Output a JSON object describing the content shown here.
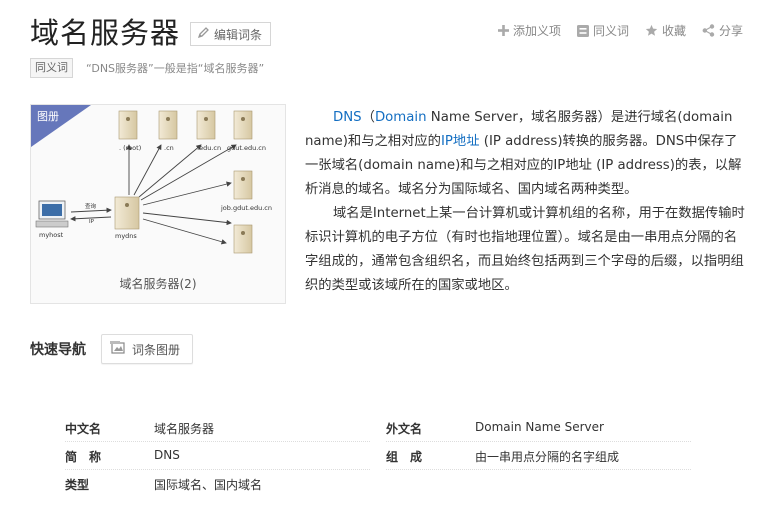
{
  "header": {
    "title": "域名服务器",
    "edit_label": "编辑词条",
    "actions": {
      "add_item": "添加义项",
      "synonym": "同义词",
      "favorite": "收藏",
      "share": "分享"
    }
  },
  "synonym": {
    "tag": "同义词",
    "text": "“DNS服务器”一般是指“域名服务器”"
  },
  "album": {
    "tag": "图册",
    "caption": "域名服务器(2)",
    "diagram_labels": {
      "root": ". (root)",
      "cn": ".cn",
      "edu_cn": ".edu.cn",
      "gdut": "gdut.edu.cn",
      "job": "job.gdut.edu.cn",
      "myhost": "myhost",
      "mydns": "mydns",
      "query": "查询",
      "ip": "IP"
    }
  },
  "summary": {
    "p1_a": "DNS",
    "p1_b": "（",
    "p1_c": "Domain",
    "p1_d": " Name Server，域名服务器）是进行域名(domain name)和与之相对应的",
    "p1_e": "IP地址",
    "p1_f": " (IP address)转换的服务器。DNS中保存了一张域名(domain name)和与之相对应的IP地址 (IP address)的表，以解析消息的域名。域名分为国际域名、国内域名两种类型。",
    "p2": "域名是Internet上某一台计算机或计算机组的名称，用于在数据传输时标识计算机的电子方位（有时也指地理位置）。域名是由一串用点分隔的名字组成的，通常包含组织名，而且始终包括两到三个字母的后缀，以指明组织的类型或该域所在的国家或地区。"
  },
  "quick_nav": {
    "label": "快速导航",
    "album_button": "词条图册"
  },
  "basic_info": {
    "left": [
      {
        "key": "中文名",
        "value": "域名服务器"
      },
      {
        "key": "简　称",
        "value": "DNS"
      },
      {
        "key": "类型",
        "value": "国际域名、国内域名"
      }
    ],
    "right": [
      {
        "key": "外文名",
        "value": "Domain Name Server"
      },
      {
        "key": "组　成",
        "value": "由一串用点分隔的名字组成"
      }
    ]
  },
  "colors": {
    "link": "#136ec2",
    "album_tag": "#6677bb",
    "server_beige": "#e8dcc0"
  }
}
